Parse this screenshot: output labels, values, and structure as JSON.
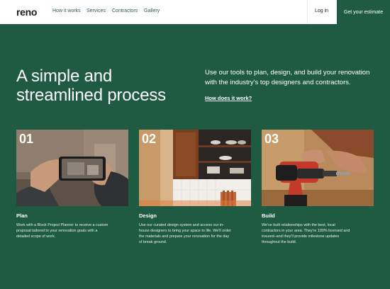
{
  "nav": {
    "logo": "reno",
    "links": [
      "How it works",
      "Services",
      "Contractors",
      "Gallery"
    ],
    "login": "Log in",
    "cta": "Get your estimate"
  },
  "hero": {
    "title": "A simple and streamlined process",
    "description": "Use our tools to plan, design, and build your renovation with the industry's top designers and contractors.",
    "link": "How does it work?"
  },
  "steps": [
    {
      "number": "01",
      "title": "Plan",
      "description": "Work with a Block Project Planner to receive a custom proposal tailored to your renovation goals with a detailed scope of work."
    },
    {
      "number": "02",
      "title": "Design",
      "description": "Use our curated design system and access our in-house designers to bring your space to life. We'll order the materials and prepare your renovation for the day of break ground."
    },
    {
      "number": "03",
      "title": "Build",
      "description": "We've built relationships with the best, local contractors in your area. They're 100% licensed and insured–and they'll provide milestone updates throughout the build."
    }
  ],
  "colors": {
    "background": "#1f5a42",
    "nav_background": "#ffffff",
    "text": "#ffffff"
  }
}
